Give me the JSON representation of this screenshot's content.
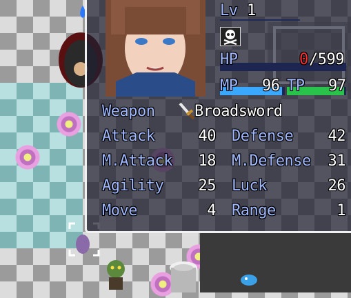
{
  "unit": {
    "level_label": "Lv",
    "level": "1",
    "status_icon": "skull-icon",
    "hp_label": "HP",
    "hp_current": "0",
    "hp_sep_max": "/599",
    "hp_fraction": 0.0,
    "mp_label": "MP",
    "mp_value": "96",
    "mp_fraction": 0.96,
    "tp_label": "TP",
    "tp_value": "97",
    "tp_fraction": 0.97,
    "weapon_label": "Weapon",
    "weapon_icon": "sword-icon",
    "weapon_name": "Broadsword"
  },
  "stats": [
    {
      "label": "Attack",
      "value": "40"
    },
    {
      "label": "Defense",
      "value": "42"
    },
    {
      "label": "M.Attack",
      "value": "18"
    },
    {
      "label": "M.Defense",
      "value": "31"
    },
    {
      "label": "Agility",
      "value": "25"
    },
    {
      "label": "Luck",
      "value": "26"
    },
    {
      "label": "Move",
      "value": "4"
    },
    {
      "label": "Range",
      "value": "1"
    }
  ],
  "colors": {
    "label": "#9fb8ff",
    "hp_zero": "#ff3030",
    "mp_bar": "#3aa8ff",
    "tp_bar": "#29c24a",
    "panel_border": "#f1f1f1"
  }
}
